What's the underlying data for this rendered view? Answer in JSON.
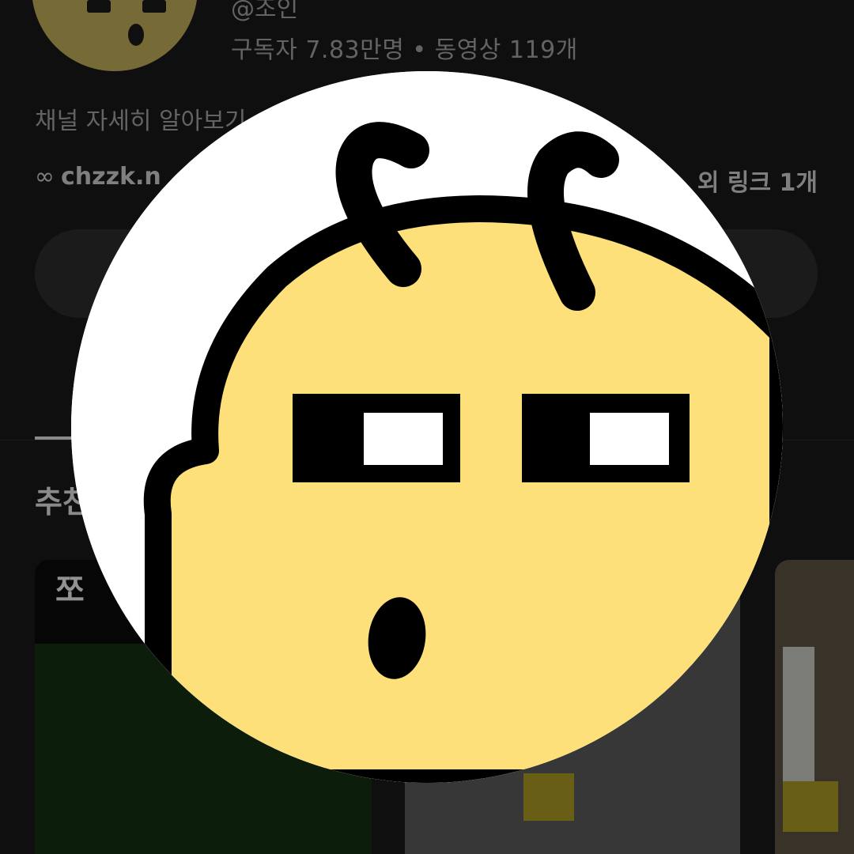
{
  "channel": {
    "handle": "@조인",
    "stats": "구독자 7.83만명 • 동영상 119개",
    "about_label": "채널 자세히 알아보기",
    "link_text": "chzzk.n",
    "link_icon": "link-icon",
    "more_links": "외 링크 1개"
  },
  "section": {
    "title": "추천"
  },
  "videos": [
    {
      "thumb_text": "쪼"
    },
    {
      "thumb_text": ""
    },
    {
      "thumb_text": ""
    }
  ],
  "colors": {
    "background": "#0f0f0f",
    "avatar_yellow": "#fde07a",
    "outline": "#000000"
  }
}
